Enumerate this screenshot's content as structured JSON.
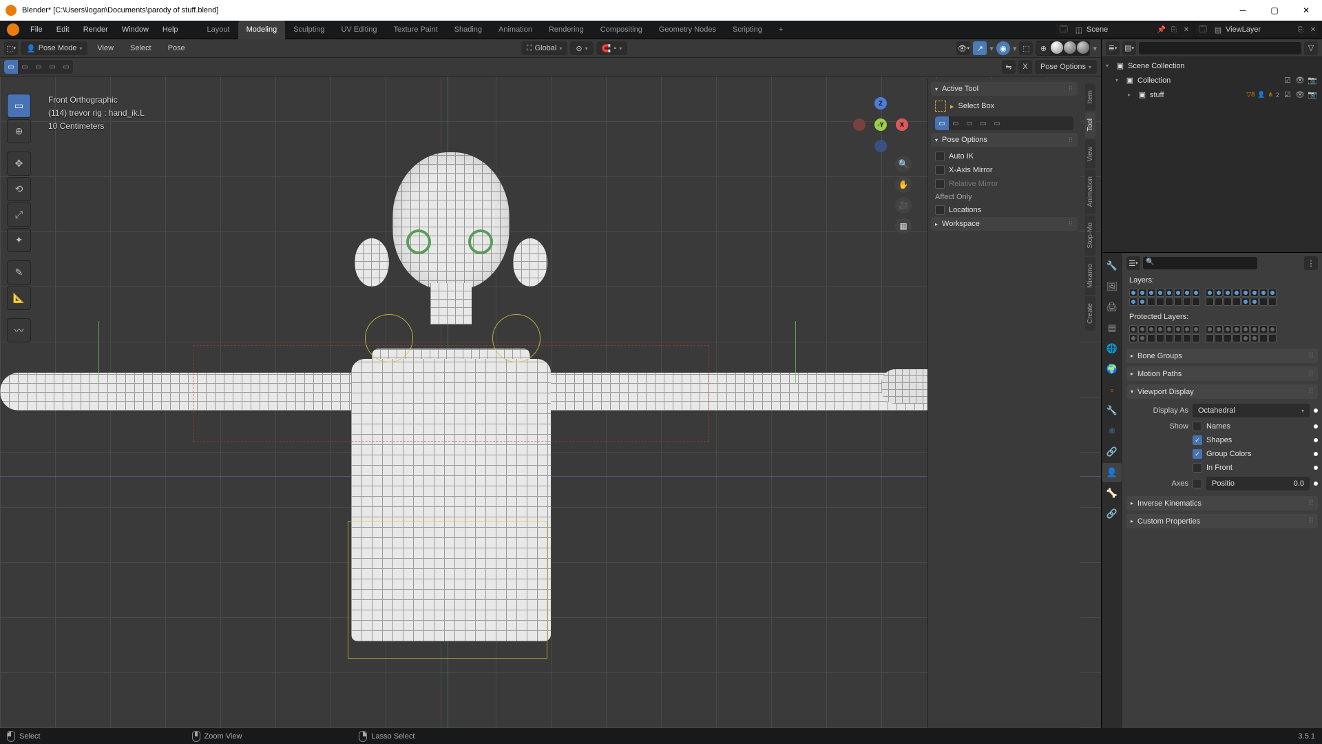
{
  "window": {
    "title": "Blender* [C:\\Users\\logan\\Documents\\parody of stuff.blend]"
  },
  "topmenu": [
    "File",
    "Edit",
    "Render",
    "Window",
    "Help"
  ],
  "workspaces": [
    "Layout",
    "Modeling",
    "Sculpting",
    "UV Editing",
    "Texture Paint",
    "Shading",
    "Animation",
    "Rendering",
    "Compositing",
    "Geometry Nodes",
    "Scripting"
  ],
  "workspace_active": "Modeling",
  "scene_name": "Scene",
  "viewlayer_name": "ViewLayer",
  "vp_header": {
    "mode": "Pose Mode",
    "menus": [
      "View",
      "Select",
      "Pose"
    ],
    "orientation": "Global",
    "pose_options_btn": "Pose Options"
  },
  "overlay": {
    "line1": "Front Orthographic",
    "line2": "(114) trevor rig : hand_ik.L",
    "line3": "10 Centimeters"
  },
  "n_panel": {
    "tabs": [
      "Item",
      "Tool",
      "View",
      "Animation",
      "Stop-Mo",
      "Mixamo",
      "Create"
    ],
    "tab_active": "Tool",
    "active_tool": "Active Tool",
    "select_box": "Select Box",
    "pose_options": "Pose Options",
    "auto_ik": "Auto IK",
    "xmirror": "X-Axis Mirror",
    "relmirror": "Relative Mirror",
    "affect_only": "Affect Only",
    "locations": "Locations",
    "workspace": "Workspace"
  },
  "outliner": {
    "scene_collection": "Scene Collection",
    "collection": "Collection",
    "item": "stuff",
    "badge": "8"
  },
  "props": {
    "layers_label": "Layers:",
    "protected_label": "Protected Layers:",
    "panels": {
      "bone_groups": "Bone Groups",
      "motion_paths": "Motion Paths",
      "viewport_display": "Viewport Display",
      "ik": "Inverse Kinematics",
      "custom": "Custom Properties"
    },
    "display_as_label": "Display As",
    "display_as_value": "Octahedral",
    "show_label": "Show",
    "names": "Names",
    "shapes": "Shapes",
    "group_colors": "Group Colors",
    "in_front": "In Front",
    "axes_label": "Axes",
    "position_label": "Positio",
    "position_value": "0.0"
  },
  "statusbar": {
    "select": "Select",
    "zoom": "Zoom View",
    "lasso": "Lasso Select",
    "version": "3.5.1"
  },
  "gizmo": {
    "x": "X",
    "y": "-Y",
    "z": "Z"
  }
}
